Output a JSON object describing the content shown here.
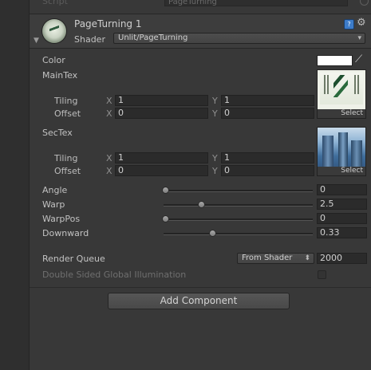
{
  "script_row": {
    "label": "Script",
    "value": "PageTurning"
  },
  "material": {
    "name": "PageTurning 1",
    "shader_label": "Shader",
    "shader_value": "Unlit/PageTurning"
  },
  "icons": {
    "foldout": "▼",
    "dropdown_arrow": "▾",
    "help_book": "?",
    "gear": "⚙",
    "color_picker": "⟋"
  },
  "properties": {
    "color": {
      "label": "Color",
      "value": "#ffffff"
    },
    "main_tex": {
      "label": "MainTex",
      "tiling_label": "Tiling",
      "offset_label": "Offset",
      "x_label": "X",
      "y_label": "Y",
      "tiling_x": "1",
      "tiling_y": "1",
      "offset_x": "0",
      "offset_y": "0",
      "select_label": "Select"
    },
    "sec_tex": {
      "label": "SecTex",
      "tiling_label": "Tiling",
      "offset_label": "Offset",
      "x_label": "X",
      "y_label": "Y",
      "tiling_x": "1",
      "tiling_y": "1",
      "offset_x": "0",
      "offset_y": "0",
      "select_label": "Select"
    },
    "angle": {
      "label": "Angle",
      "value": "0",
      "fraction": 0.0
    },
    "warp": {
      "label": "Warp",
      "value": "2.5",
      "fraction": 0.25
    },
    "warp_pos": {
      "label": "WarpPos",
      "value": "0",
      "fraction": 0.0
    },
    "downward": {
      "label": "Downward",
      "value": "0.33",
      "fraction": 0.33
    }
  },
  "render_queue": {
    "label": "Render Queue",
    "mode": "From Shader",
    "value": "2000"
  },
  "dsgi": {
    "label": "Double Sided Global Illumination",
    "checked": false
  },
  "add_component": {
    "label": "Add Component"
  },
  "colors": {
    "panel_bg": "#383838",
    "field_bg": "#2b2b2b",
    "text": "#c2c2c2",
    "accent": "#3d7cc9"
  }
}
